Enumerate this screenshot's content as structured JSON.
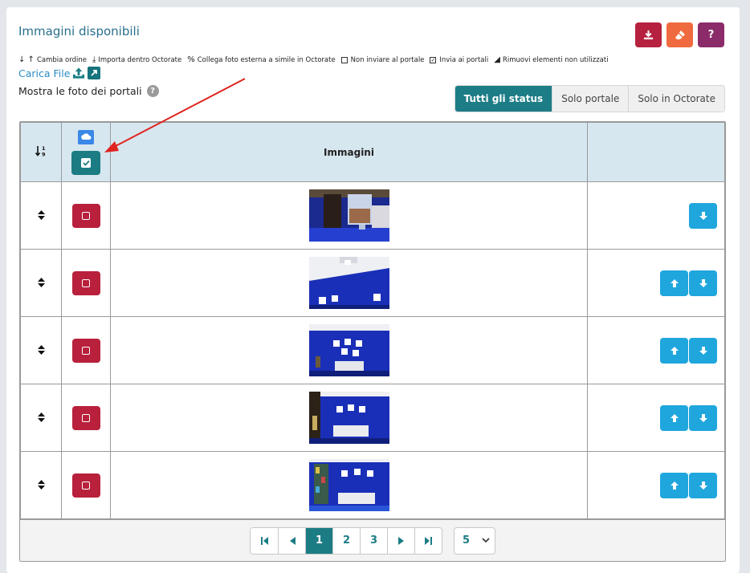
{
  "title": "Immagini disponibili",
  "header_buttons": [
    {
      "name": "download-button",
      "icon": "download-icon",
      "color": "#b5213e"
    },
    {
      "name": "eraser-button",
      "icon": "eraser-icon",
      "color": "#f06a3f"
    },
    {
      "name": "help-button",
      "icon": "question-icon",
      "label": "?",
      "color": "#8c2b6a"
    }
  ],
  "legend": [
    {
      "icon": "arrows-up-down-icon",
      "glyph": "↓ ↑",
      "label": "Cambia ordine"
    },
    {
      "icon": "download-icon",
      "glyph": "⤓",
      "label": "Importa dentro Octorate"
    },
    {
      "icon": "link-icon",
      "glyph": "%",
      "label": "Collega foto esterna a simile in Octorate"
    },
    {
      "icon": "checkbox-empty-icon",
      "glyph": "",
      "label": "Non inviare al portale"
    },
    {
      "icon": "checkbox-checked-icon",
      "glyph": "✓",
      "label": "Invia ai portali"
    },
    {
      "icon": "eraser-icon",
      "glyph": "◢",
      "label": "Rimuovi elementi non utilizzati"
    }
  ],
  "upload": {
    "label": "Carica File"
  },
  "mostra": {
    "label": "Mostra le foto dei portali"
  },
  "status_filter": {
    "options": [
      "Tutti gli status",
      "Solo portale",
      "Solo in Octorate"
    ],
    "selected": "Tutti gli status"
  },
  "table": {
    "columns": {
      "sort": "↓¹₉",
      "images": "Immagini"
    },
    "rows": [
      {
        "scene": "window",
        "actions": [
          "down"
        ]
      },
      {
        "scene": "ceiling",
        "actions": [
          "up",
          "down"
        ]
      },
      {
        "scene": "bedroom-wide",
        "actions": [
          "up",
          "down"
        ]
      },
      {
        "scene": "bedroom-door",
        "actions": [
          "up",
          "down"
        ]
      },
      {
        "scene": "bedroom-stained",
        "actions": [
          "up",
          "down"
        ]
      }
    ]
  },
  "pagination": {
    "pages": [
      "1",
      "2",
      "3"
    ],
    "current": "1",
    "per_page": "5"
  },
  "colors": {
    "teal": "#1b7c84",
    "red": "#b8203c",
    "blue_button": "#1fa6dd",
    "header_bg": "#d7e7ef"
  }
}
